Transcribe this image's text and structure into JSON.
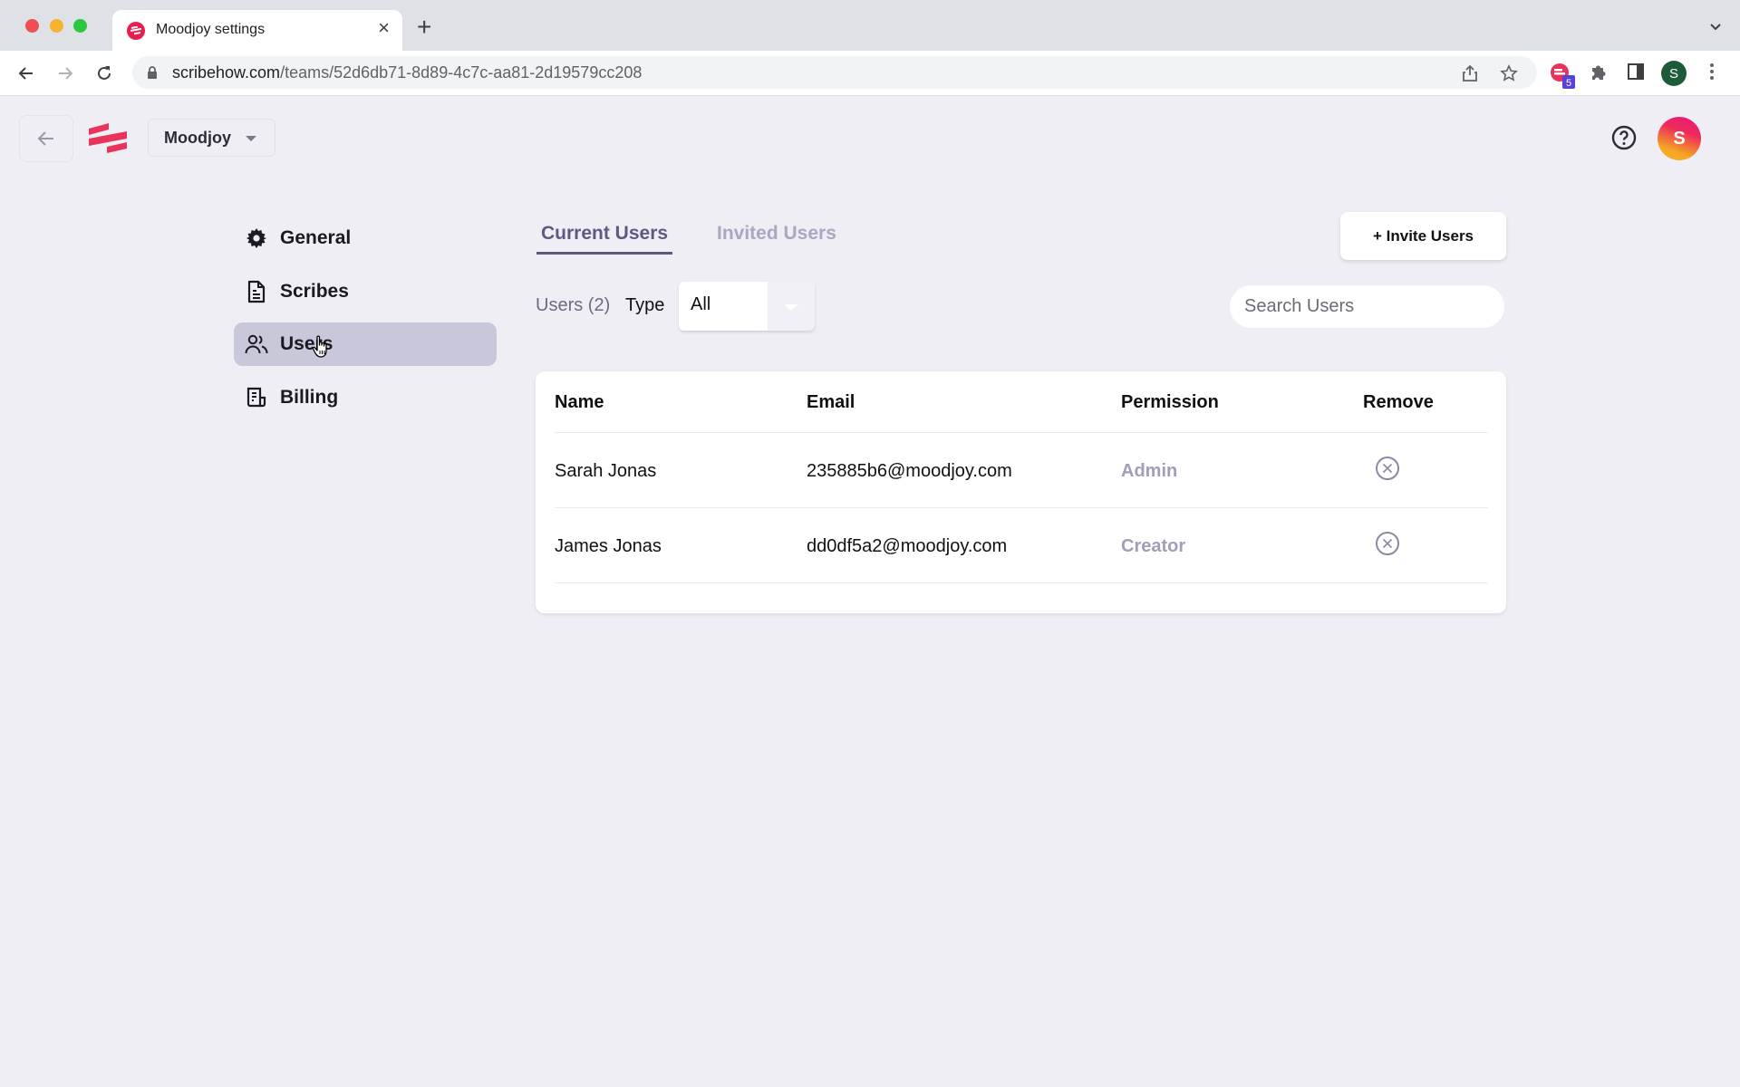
{
  "browser": {
    "tab_title": "Moodjoy settings",
    "url_host": "scribehow.com",
    "url_path": "/teams/52d6db71-8d89-4c7c-aa81-2d19579cc208",
    "extension_badge": "5",
    "profile_initial": "S"
  },
  "header": {
    "team_name": "Moodjoy",
    "avatar_initial": "S"
  },
  "sidebar": {
    "items": [
      {
        "label": "General",
        "icon": "gear-icon"
      },
      {
        "label": "Scribes",
        "icon": "document-icon"
      },
      {
        "label": "Users",
        "icon": "users-icon",
        "active": true
      },
      {
        "label": "Billing",
        "icon": "billing-icon"
      }
    ]
  },
  "main": {
    "tabs": [
      {
        "label": "Current Users",
        "active": true
      },
      {
        "label": "Invited Users",
        "active": false
      }
    ],
    "invite_button": "+ Invite Users",
    "users_count": "Users (2)",
    "type_label": "Type",
    "type_value": "All",
    "search_placeholder": "Search Users",
    "table": {
      "headers": [
        "Name",
        "Email",
        "Permission",
        "Remove"
      ],
      "rows": [
        {
          "name": "Sarah Jonas",
          "email": "235885b6@moodjoy.com",
          "permission": "Admin"
        },
        {
          "name": "James Jonas",
          "email": "dd0df5a2@moodjoy.com",
          "permission": "Creator"
        }
      ]
    }
  },
  "colors": {
    "brand": "#e8335a",
    "accent": "#5c5a85",
    "muted_permission": "#a09eb8"
  }
}
